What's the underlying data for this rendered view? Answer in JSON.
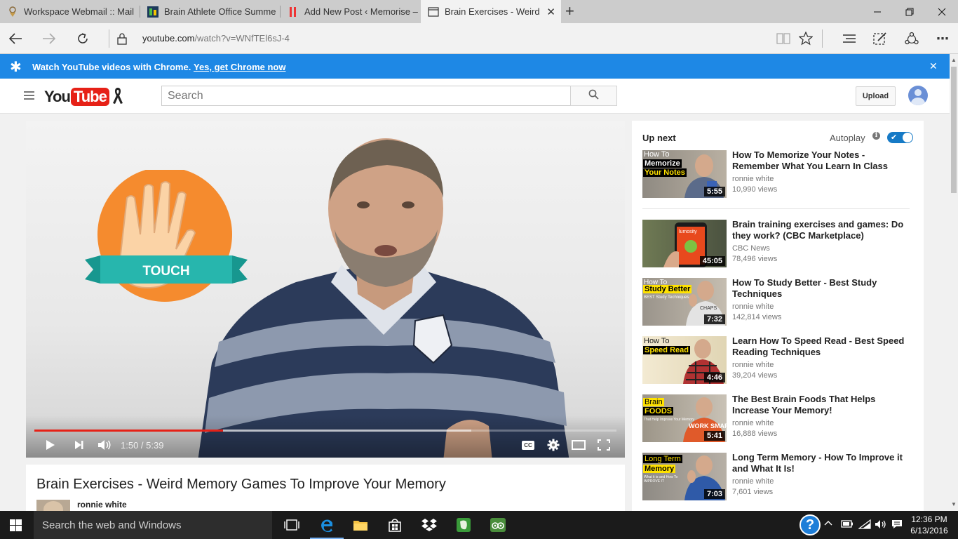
{
  "browser": {
    "tabs": [
      {
        "title": "Workspace Webmail :: Mail"
      },
      {
        "title": "Brain Athlete Office Summe"
      },
      {
        "title": "Add New Post ‹ Memorise –"
      },
      {
        "title": "Brain Exercises - Weird M"
      }
    ],
    "new_tab_symbol": "+",
    "url_host": "youtube.com",
    "url_path": "/watch?v=WNfTEl6sJ-4"
  },
  "banner": {
    "message": "Watch YouTube videos with Chrome.",
    "link": "Yes, get Chrome now",
    "period": "."
  },
  "masthead": {
    "logo_you": "You",
    "logo_tube": "Tube",
    "search_placeholder": "Search",
    "upload_label": "Upload"
  },
  "player": {
    "graphic_label": "TOUCH",
    "time_current": "1:50",
    "time_total": "5:39",
    "progress": 0.324,
    "buffered": 0.75,
    "cc_label": "CC"
  },
  "video": {
    "title": "Brain Exercises - Weird Memory Games To Improve Your Memory",
    "owner": "ronnie white"
  },
  "sidebar": {
    "up_next_label": "Up next",
    "autoplay_label": "Autoplay",
    "autoplay_on": true,
    "videos": [
      {
        "title": "How To Memorize Your Notes - Remember What You Learn In Class",
        "channel": "ronnie white",
        "views": "10,990 views",
        "duration": "5:55",
        "thumb_line1": "How To",
        "thumb_line2": "Memorize",
        "thumb_line3": "Your Notes"
      },
      {
        "title": "Brain training exercises and games: Do they work? (CBC Marketplace)",
        "channel": "CBC News",
        "views": "78,496 views",
        "duration": "45:05",
        "thumb_line1": "lumosity"
      },
      {
        "title": "How To Study Better - Best Study Techniques",
        "channel": "ronnie white",
        "views": "142,814 views",
        "duration": "7:32",
        "thumb_line1": "How To",
        "thumb_line2": "Study Better",
        "thumb_line3": "BEST Study Techniques",
        "thumb_shirt": "CHAPS"
      },
      {
        "title": "Learn How To Speed Read - Best Speed Reading Techniques",
        "channel": "ronnie white",
        "views": "39,204 views",
        "duration": "4:46",
        "thumb_line1": "How To",
        "thumb_line2": "Speed Read"
      },
      {
        "title": "The Best Brain Foods That Helps Increase Your Memory!",
        "channel": "ronnie white",
        "views": "16,888 views",
        "duration": "5:41",
        "thumb_line1": "Brain",
        "thumb_line2": "FOODS",
        "thumb_line3": "That Help Improve Your Memory",
        "thumb_shirt": "WORK SMAR"
      },
      {
        "title": "Long Term Memory - How To Improve it and What It Is!",
        "channel": "ronnie white",
        "views": "7,601 views",
        "duration": "7:03",
        "thumb_line1": "Long Term",
        "thumb_line2": "Memory",
        "thumb_line3": "What it is and How To IMPROVE IT"
      }
    ]
  },
  "taskbar": {
    "search_placeholder": "Search the web and Windows",
    "help_symbol": "?",
    "time": "12:36 PM",
    "date": "6/13/2016"
  },
  "colors": {
    "youtube_red": "#e62117",
    "banner_blue": "#1e88e5",
    "toggle_blue": "#167ac6",
    "thumb_yellow": "#ffe200"
  }
}
